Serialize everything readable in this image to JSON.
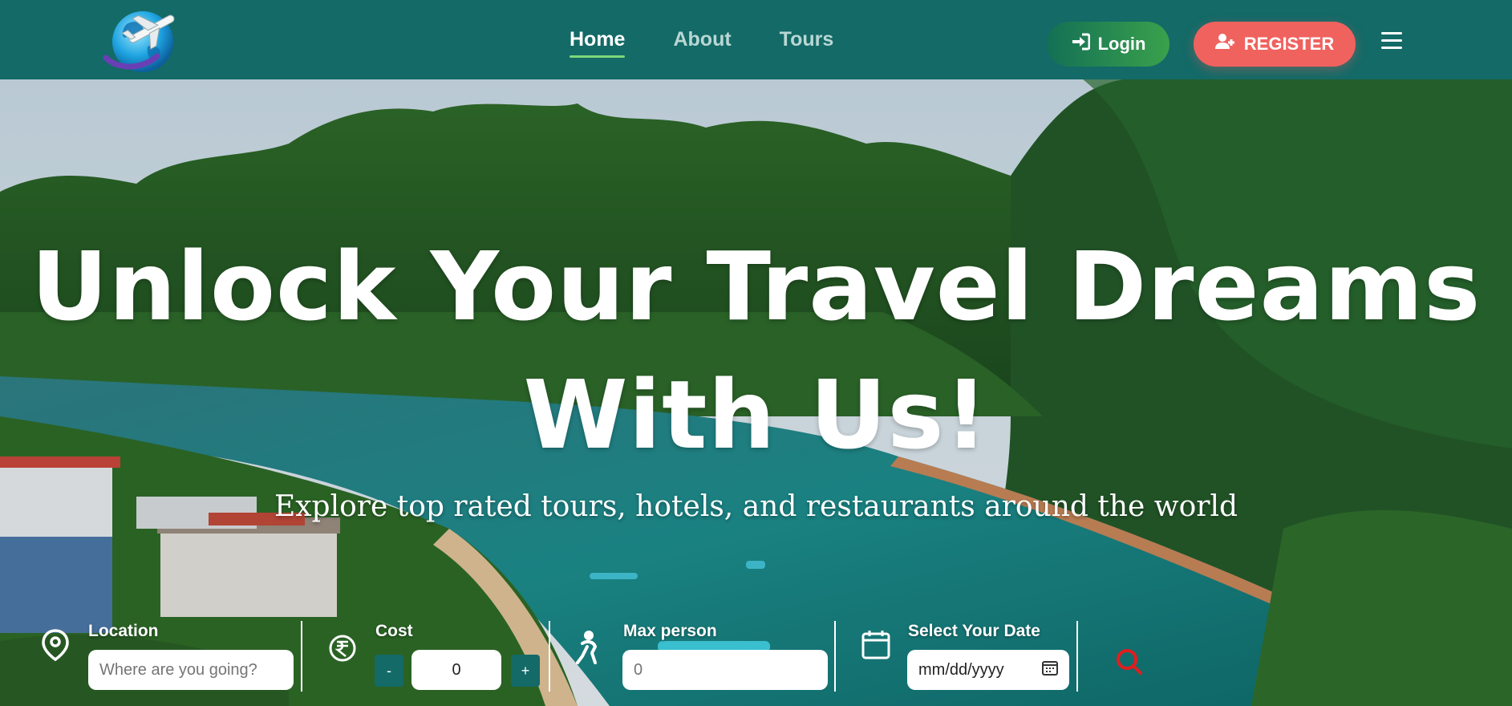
{
  "nav": {
    "links": [
      {
        "label": "Home",
        "active": true
      },
      {
        "label": "About",
        "active": false
      },
      {
        "label": "Tours",
        "active": false
      }
    ],
    "login_label": "Login",
    "register_label": "REGISTER"
  },
  "hero": {
    "title_line1": "Unlock Your Travel Dreams",
    "title_line2": "With Us!",
    "subtitle": "Explore top rated tours, hotels, and restaurants around the world"
  },
  "search": {
    "location": {
      "label": "Location",
      "placeholder": "Where are you going?",
      "icon": "map-pin-icon"
    },
    "cost": {
      "label": "Cost",
      "value": "0",
      "minus": "-",
      "plus": "+",
      "icon": "rupee-icon"
    },
    "max_person": {
      "label": "Max person",
      "placeholder": "0",
      "icon": "person-icon"
    },
    "date": {
      "label": "Select Your Date",
      "placeholder": "mm/dd/yyyy",
      "icon": "calendar-icon"
    },
    "search_icon": "search-icon"
  },
  "colors": {
    "navbar": "#136a67",
    "register": "#f0625e",
    "login_gradient_start": "#137055",
    "login_gradient_end": "#3aa14c",
    "search_icon": "#e01e1e"
  }
}
